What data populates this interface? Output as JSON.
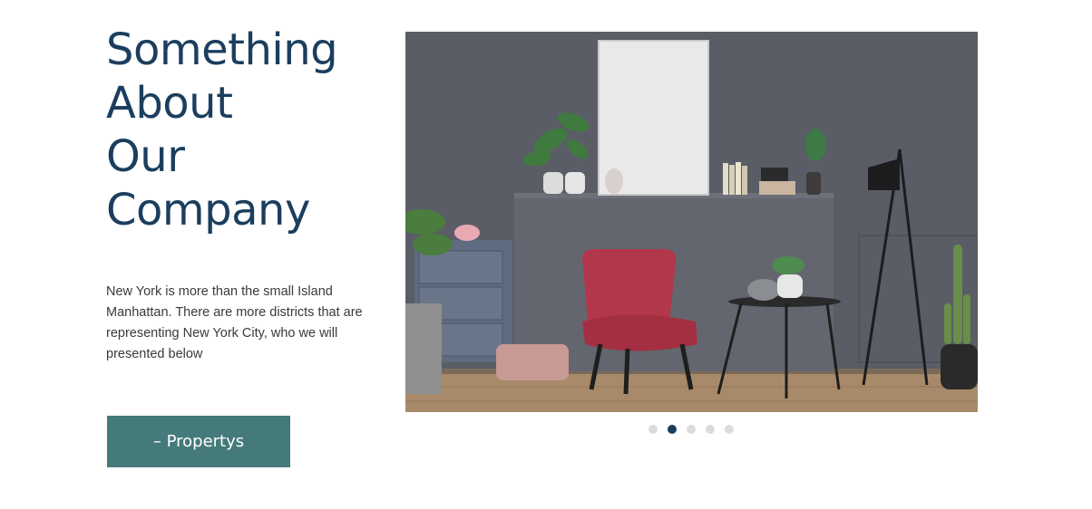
{
  "hero": {
    "heading_lines": [
      "Something",
      "About",
      "Our",
      "Company"
    ],
    "description": "New York is more than the small Island Manhattan. There are more districts that are representing New York City, who we will presented below",
    "cta_label": "– Propertys"
  },
  "slider": {
    "image_alt": "Living room interior with red armchair",
    "dots": [
      {
        "active": false
      },
      {
        "active": true
      },
      {
        "active": false
      },
      {
        "active": false
      },
      {
        "active": false
      }
    ]
  },
  "colors": {
    "heading": "#1b3e5e",
    "button": "#457a7b",
    "dot_active": "#1b3e5e",
    "dot_inactive": "#dcdcdc"
  }
}
